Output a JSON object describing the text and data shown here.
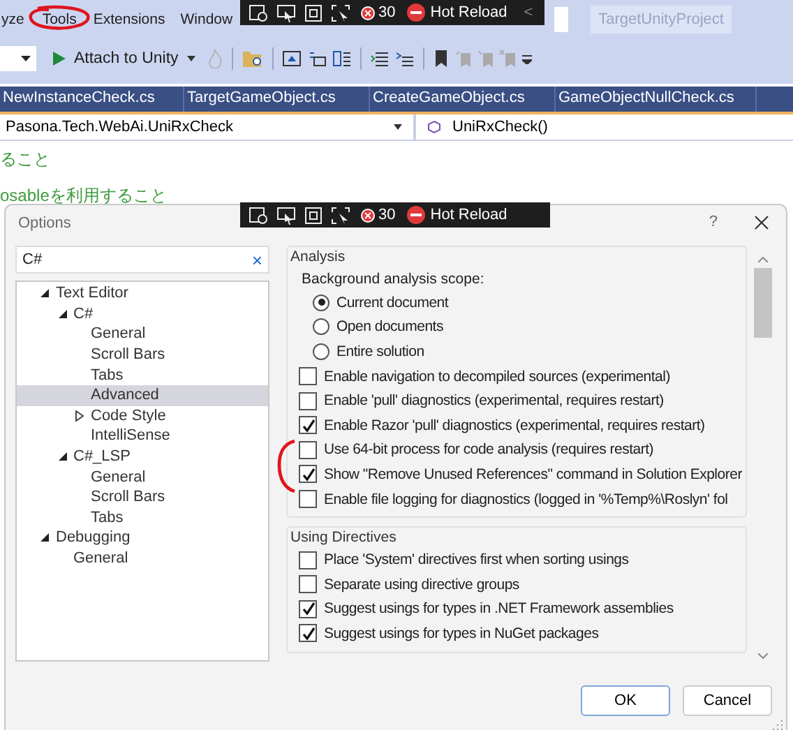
{
  "menu_bar": {
    "items": [
      "yze",
      "Tools",
      "Extensions",
      "Window"
    ],
    "project": "TargetUnityProject"
  },
  "hot_reload_bars": [
    {
      "count": "30",
      "label": "Hot Reload",
      "chevron": "<"
    },
    {
      "count": "30",
      "label": "Hot Reload"
    }
  ],
  "toolbar": {
    "attach_button": "Attach to Unity"
  },
  "tabs": [
    "NewInstanceCheck.cs",
    "TargetGameObject.cs",
    "CreateGameObject.cs",
    "GameObjectNullCheck.cs"
  ],
  "nav_bar": {
    "type": "Pasona.Tech.WebAi.UniRxCheck",
    "member": "UniRxCheck()"
  },
  "editor": {
    "lines": [
      "ること",
      "osableを利用すること"
    ]
  },
  "dialog": {
    "title": "Options",
    "help": "?",
    "search": {
      "value": "C#",
      "clear": "×"
    },
    "tree": [
      {
        "label": "Text Editor",
        "expanded": true,
        "selected": false,
        "children": [
          {
            "label": "C#",
            "expanded": true,
            "selected": false,
            "children": [
              {
                "label": "General",
                "selected": false
              },
              {
                "label": "Scroll Bars",
                "selected": false
              },
              {
                "label": "Tabs",
                "selected": false
              },
              {
                "label": "Advanced",
                "selected": true
              },
              {
                "label": "Code Style",
                "expanded": false,
                "selected": false
              },
              {
                "label": "IntelliSense",
                "selected": false
              }
            ]
          },
          {
            "label": "C#_LSP",
            "expanded": true,
            "selected": false,
            "children": [
              {
                "label": "General",
                "selected": false
              },
              {
                "label": "Scroll Bars",
                "selected": false
              },
              {
                "label": "Tabs",
                "selected": false
              }
            ]
          }
        ]
      },
      {
        "label": "Debugging",
        "expanded": true,
        "selected": false,
        "children": [
          {
            "label": "General",
            "selected": false
          }
        ]
      }
    ],
    "groups": [
      {
        "title": "Analysis",
        "items": [
          {
            "kind": "label",
            "text": "Background analysis scope:"
          },
          {
            "kind": "radio",
            "text": "Current document",
            "selected": true
          },
          {
            "kind": "radio",
            "text": "Open documents",
            "selected": false
          },
          {
            "kind": "radio",
            "text": "Entire solution",
            "selected": false
          },
          {
            "kind": "checkbox",
            "text": "Enable navigation to decompiled sources (experimental)",
            "checked": false
          },
          {
            "kind": "checkbox",
            "text": "Enable 'pull' diagnostics (experimental, requires restart)",
            "checked": false
          },
          {
            "kind": "checkbox",
            "text": "Enable Razor 'pull' diagnostics (experimental, requires restart)",
            "checked": true
          },
          {
            "kind": "checkbox",
            "text": "Use 64-bit process for code analysis (requires restart)",
            "checked": false
          },
          {
            "kind": "checkbox",
            "text": "Show \"Remove Unused References\" command in Solution Explorer",
            "checked": true
          },
          {
            "kind": "checkbox",
            "text": "Enable file logging for diagnostics (logged in '%Temp%\\Roslyn' fol",
            "checked": false
          }
        ]
      },
      {
        "title": "Using Directives",
        "items": [
          {
            "kind": "checkbox",
            "text": "Place 'System' directives first when sorting usings",
            "checked": false
          },
          {
            "kind": "checkbox",
            "text": "Separate using directive groups",
            "checked": false
          },
          {
            "kind": "checkbox",
            "text": "Suggest usings for types in .NET Framework assemblies",
            "checked": true
          },
          {
            "kind": "checkbox",
            "text": "Suggest usings for types in NuGet packages",
            "checked": true
          }
        ]
      }
    ],
    "buttons": [
      "OK",
      "Cancel"
    ]
  }
}
